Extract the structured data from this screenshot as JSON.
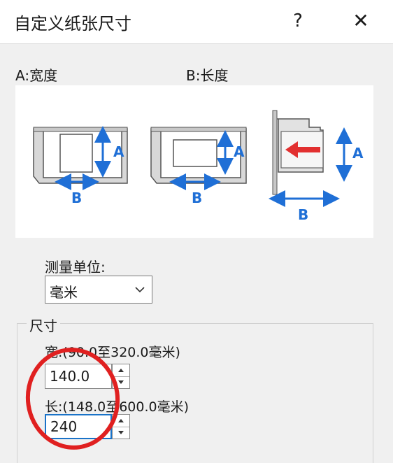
{
  "titlebar": {
    "title": "自定义纸张尺寸",
    "help_icon": "?",
    "close_icon": "✕"
  },
  "diagram": {
    "label_a": "A:宽度",
    "label_b": "B:长度",
    "axis_a": "A",
    "axis_b": "B"
  },
  "units": {
    "label": "测量单位:",
    "selected": "毫米"
  },
  "dimensions": {
    "group_title": "尺寸",
    "width": {
      "label": "宽:(90.0至320.0毫米)",
      "value": "140.0"
    },
    "length": {
      "label": "长:(148.0至600.0毫米)",
      "value": "240"
    }
  },
  "colors": {
    "arrow_blue": "#1f6fd6",
    "annotation_red": "#e02020",
    "insert_arrow_red": "#e23030"
  }
}
